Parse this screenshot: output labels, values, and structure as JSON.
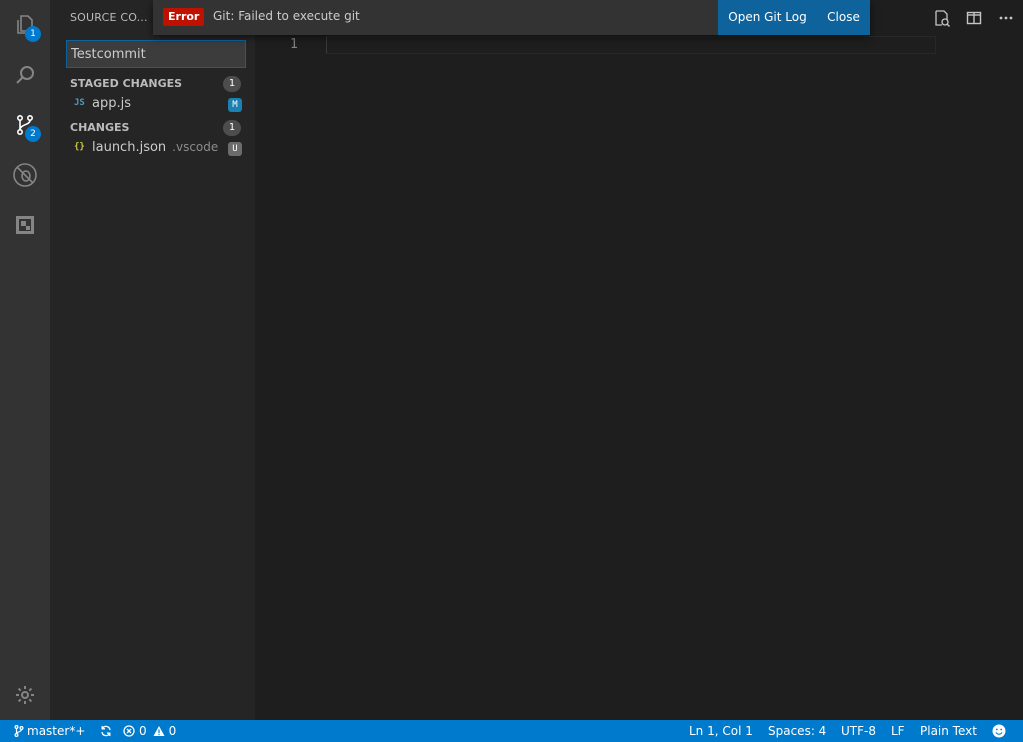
{
  "activity_bar": {
    "explorer_badge": "1",
    "scm_badge": "2"
  },
  "sidebar": {
    "title": "SOURCE CO...",
    "commit_message": "Testcommit",
    "staged": {
      "header": "STAGED CHANGES",
      "count": "1",
      "files": [
        {
          "icon": "JS",
          "name": "app.js",
          "dir": "",
          "status": "M"
        }
      ]
    },
    "changes": {
      "header": "CHANGES",
      "count": "1",
      "files": [
        {
          "icon": "{}",
          "name": "launch.json",
          "dir": ".vscode",
          "status": "U"
        }
      ]
    }
  },
  "notification": {
    "severity": "Error",
    "message": "Git: Failed to execute git",
    "actions": [
      "Open Git Log",
      "Close"
    ]
  },
  "editor": {
    "line_number": "1"
  },
  "statusbar": {
    "branch": "master*+",
    "errors": "0",
    "warnings": "0",
    "cursor": "Ln 1, Col 1",
    "indent": "Spaces: 4",
    "encoding": "UTF-8",
    "eol": "LF",
    "language": "Plain Text"
  },
  "colors": {
    "accent": "#007acc",
    "error": "#be1100",
    "modified": "#1b80b2",
    "untracked": "#6c6c6c",
    "json_icon": "#cbcb41",
    "js_icon": "#519aba"
  },
  "icons": {
    "activity": [
      "files-icon",
      "search-icon",
      "source-control-icon",
      "debug-icon",
      "extensions-icon",
      "settings-gear-icon"
    ],
    "editor_actions": [
      "open-changes-icon",
      "split-editor-icon",
      "more-actions-icon"
    ],
    "status": [
      "git-branch-icon",
      "sync-icon",
      "error-icon",
      "warning-icon",
      "feedback-smiley-icon"
    ]
  }
}
